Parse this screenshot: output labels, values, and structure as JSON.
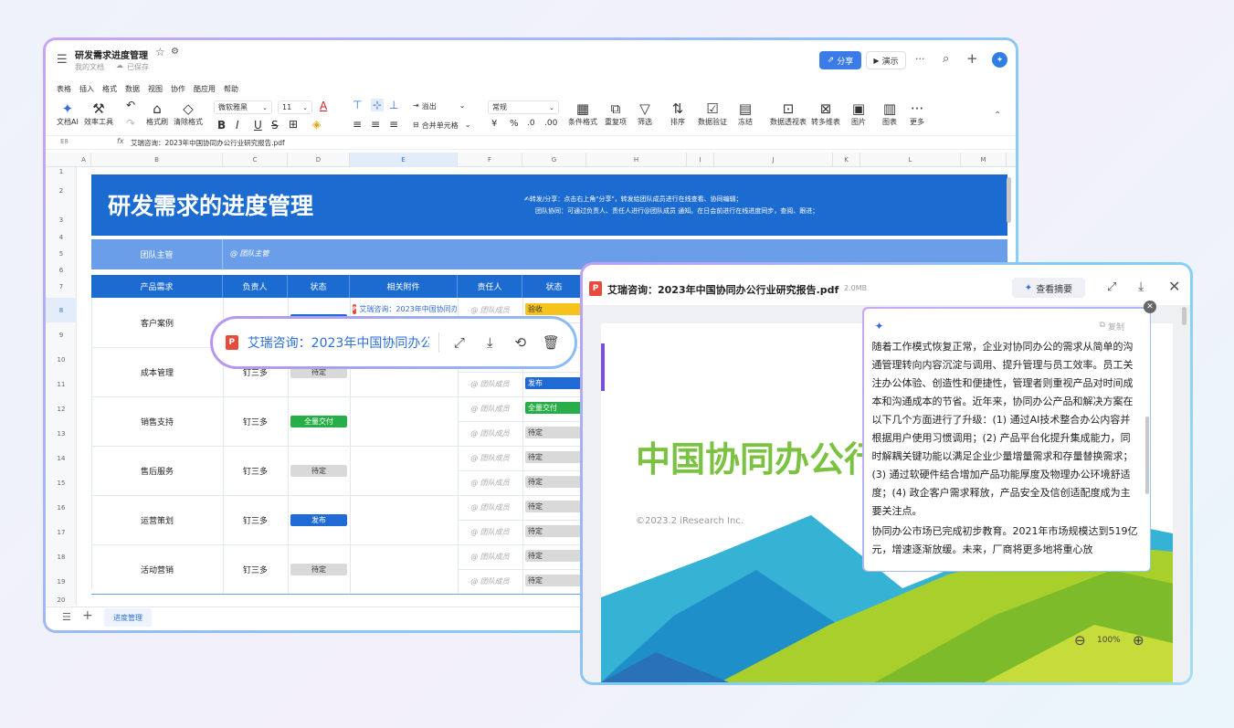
{
  "doc": {
    "title": "研发需求进度管理",
    "location": "我的文档",
    "save_status": "已保存",
    "share_label": "分享",
    "present_label": "演示",
    "more_label": "···"
  },
  "menu": [
    "表格",
    "插入",
    "格式",
    "数据",
    "视图",
    "协作",
    "酷应用",
    "帮助"
  ],
  "toolbar": {
    "doc_ai": "文档AI",
    "efficiency": "效率工具",
    "format_painter": "格式刷",
    "clear_format": "清除格式",
    "font_name": "微软雅黑",
    "font_size": "11",
    "overflow": "溢出",
    "merge": "合并单元格",
    "number_format": "常规",
    "bold": "B",
    "italic": "I",
    "underline": "U",
    "strike": "S",
    "font_color": "A",
    "currency": "¥",
    "percent": "%",
    "cond_format": "条件格式",
    "duplicate": "重复项",
    "filter": "筛选",
    "sort": "排序",
    "validation": "数据验证",
    "freeze": "冻结",
    "pivot": "数据透视表",
    "to_dashboard": "转多维表",
    "image": "图片",
    "chart": "图表",
    "more": "更多"
  },
  "formula": {
    "cell_ref": "E8",
    "fx": "fx",
    "value": "艾瑞咨询：2023年中国协同办公行业研究报告.pdf"
  },
  "columns": [
    "A",
    "B",
    "C",
    "D",
    "E",
    "F",
    "G",
    "H",
    "I",
    "J",
    "K",
    "L",
    "M"
  ],
  "rows": [
    "1",
    "2",
    "3",
    "4",
    "5",
    "6",
    "7",
    "8",
    "9",
    "10",
    "11",
    "12",
    "13",
    "14",
    "15",
    "16",
    "17",
    "18",
    "19",
    "20"
  ],
  "sheet": {
    "banner_title": "研发需求的进度管理",
    "banner_note1": "✍转发/分享：点击右上角\"分享\"，转发给团队成员进行在线查看、协同编辑；",
    "banner_note2": "团队协同：可通过负责人、责任人进行@团队成员 通知。在日会前进行在线进度同步，查阅、跟进；",
    "lead_label": "团队主管",
    "lead_value": "@ 团队主管",
    "headers": [
      "产品需求",
      "负责人",
      "状态",
      "相关附件",
      "责任人",
      "状态"
    ],
    "groups": [
      {
        "name": "客户案例",
        "owner": "钉三多",
        "status": "发布"
      },
      {
        "name": "成本管理",
        "owner": "钉三多",
        "status": "待定"
      },
      {
        "name": "销售支持",
        "owner": "钉三多",
        "status": "全量交付"
      },
      {
        "name": "售后服务",
        "owner": "钉三多",
        "status": "待定"
      },
      {
        "name": "运营策划",
        "owner": "钉三多",
        "status": "发布"
      },
      {
        "name": "活动营销",
        "owner": "钉三多",
        "status": "待定"
      }
    ],
    "attachment": "艾瑞咨询：2023年中国协同办公行业研究报告.pdf",
    "member": "@ 团队成员",
    "sub_status": [
      "验收",
      "",
      "",
      "发布",
      "全量交付",
      "待定",
      "待定",
      "待定",
      "待定",
      "待定",
      "待定",
      "待定"
    ],
    "tab_name": "进度管理"
  },
  "popup": {
    "file_name": "艾瑞咨询：2023年中国协同办公..."
  },
  "preview": {
    "file_name": "艾瑞咨询：2023年中国协同办公行业研究报告.pdf",
    "file_size": "2.0MB",
    "summary_button": "查看摘要",
    "cover_title": "中国协同办公行",
    "cover_copyright": "©2023.2 iResearch Inc.",
    "zoom": "100%",
    "copy_label": "复制",
    "summary_p1": "随着工作模式恢复正常，企业对协同办公的需求从简单的沟通管理转向内容沉淀与调用、提升管理与员工效率。员工关注办公体验、创造性和便捷性，管理者则重视产品对时间成本和沟通成本的节省。近年来，协同办公产品和解决方案在以下几个方面进行了升级：(1) 通过AI技术整合办公内容并根据用户使用习惯调用；(2) 产品平台化提升集成能力，同时解耦关键功能以满足企业少量增量需求和存量替换需求；(3) 通过软硬件结合增加产品功能厚度及物理办公环境舒适度；(4) 政企客户需求释放，产品安全及信创适配度成为主要关注点。",
    "summary_p2": "协同办公市场已完成初步教育。2021年市场规模达到519亿元，增速逐渐放缓。未来，厂商将更多地将重心放"
  },
  "colors": {
    "brand_blue": "#1b6bd1",
    "tag_blue": "#1f6ad4",
    "tag_green": "#27ae48",
    "tag_grey": "#d9d9d9",
    "tag_yellow": "#f6c21c",
    "cover_green": "#7cc242"
  }
}
